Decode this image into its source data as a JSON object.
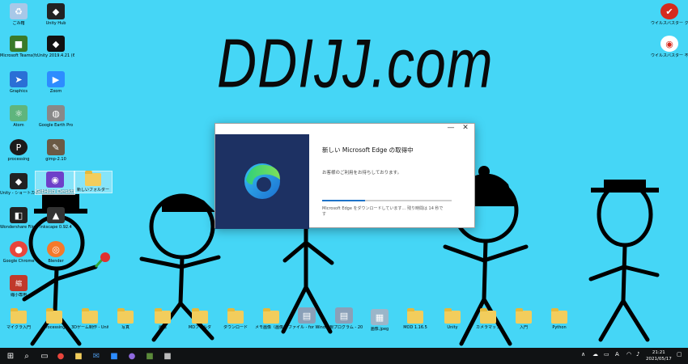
{
  "wallpaper": {
    "title": "DDIJJ.com"
  },
  "desktop_icons": [
    {
      "label": "ごみ箱",
      "icon": "recycle-bin-icon",
      "color": "#a8c8e8"
    },
    {
      "label": "Unity Hub",
      "icon": "unity-icon",
      "color": "#222222"
    },
    {
      "label": "Microsoft Teams(for work)",
      "icon": "minecraft-icon",
      "color": "#3a7a2a"
    },
    {
      "label": "Unity 2019.4.21 (64-bit)",
      "icon": "unity-icon",
      "color": "#111111"
    },
    {
      "label": "Graphics",
      "icon": "app-icon",
      "color": "#2a6fd6"
    },
    {
      "label": "Zoom",
      "icon": "zoom-icon",
      "color": "#2d8cff"
    },
    {
      "label": "Atom",
      "icon": "atom-icon",
      "color": "#5fb57d"
    },
    {
      "label": "Google Earth Pro",
      "icon": "google-earth-icon",
      "color": "#888888"
    },
    {
      "label": "processing",
      "icon": "processing-icon",
      "color": "#1b1b1b"
    },
    {
      "label": "gimp-2.10",
      "icon": "gimp-icon",
      "color": "#6b5a45"
    },
    {
      "label": "Unity - ショートカット",
      "icon": "unity-icon",
      "color": "#222222"
    },
    {
      "label": "GitHub Desktop",
      "icon": "github-desktop-icon",
      "color": "#6e40c9"
    },
    {
      "label": "新しいフォルダー",
      "icon": "folder-icon",
      "color": "#f2cd5c"
    },
    {
      "label": "Wondershare Filmora9",
      "icon": "filmora-icon",
      "color": "#222222"
    },
    {
      "label": "Inkscape 0.92.4",
      "icon": "inkscape-icon",
      "color": "#333333"
    },
    {
      "label": "Google Chrome",
      "icon": "chrome-icon",
      "color": "#e8453c"
    },
    {
      "label": "Blender",
      "icon": "blender-icon",
      "color": "#f5792a"
    },
    {
      "label": "縮小専用",
      "icon": "shukusen-icon",
      "color": "#c0392b"
    }
  ],
  "right_icons": [
    {
      "label": "ウイルスバスター クラウド",
      "icon": "virus-buster-icon",
      "color": "#d52b1e"
    },
    {
      "label": "ウイルスバスター 不正変更監視ツール",
      "icon": "virus-buster-icon",
      "color": "#d52b1e"
    }
  ],
  "bottom_folders": [
    "マイクラ入門",
    "processing",
    "3Dゲーム制作 - Unity",
    "写真",
    "画像",
    "MDフォルダ",
    "ダウンロード",
    "メモ画像（画像）",
    "ファイル - for Windows - 入門",
    "新規プログラム - 2021",
    "画像.jpeg",
    "MOD 1.16.5",
    "Unity",
    "カメラマップ",
    "入門",
    "Python"
  ],
  "edge_dialog": {
    "title": "新しい Microsoft Edge の取得中",
    "message": "お客様のご利用をお待ちしております。",
    "status": "Microsoft Edge をダウンロードしています… 残り時間は 14 秒です",
    "progress": 0.33,
    "minimize": "—",
    "close": "✕"
  },
  "taskbar": {
    "start_icon": "⊞",
    "search_icon": "⌕",
    "apps": [
      {
        "icon": "task-view-icon",
        "glyph": "▭",
        "color": "#ffffff"
      },
      {
        "icon": "chrome-icon",
        "glyph": "●",
        "color": "#e8453c"
      },
      {
        "icon": "file-explorer-icon",
        "glyph": "■",
        "color": "#f2cd5c"
      },
      {
        "icon": "mail-icon",
        "glyph": "✉",
        "color": "#4a90d9"
      },
      {
        "icon": "zoom-icon",
        "glyph": "■",
        "color": "#2d8cff"
      },
      {
        "icon": "teams-icon",
        "glyph": "●",
        "color": "#8f6adf"
      },
      {
        "icon": "minecraft-icon",
        "glyph": "■",
        "color": "#5b8a3a"
      },
      {
        "icon": "edge-setup-icon",
        "glyph": "■",
        "color": "#bbbbbb"
      }
    ],
    "tray_ime": "A",
    "clock_time": "21:21",
    "clock_date": "2021/05/17"
  }
}
